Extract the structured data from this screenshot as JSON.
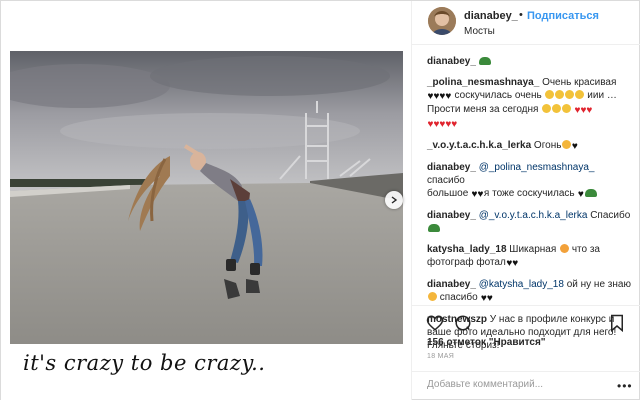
{
  "photo": {
    "caption": "it's crazy to be crazy..",
    "sky_color": "#8f8f95",
    "ground_color": "#9a9894"
  },
  "header": {
    "username": "dianabey_",
    "separator": "•",
    "follow_label": "Подписаться",
    "location": "Мосты"
  },
  "comments": [
    {
      "user": "dianabey_",
      "parts": [
        {
          "t": "emoji",
          "v": "turtle"
        }
      ]
    },
    {
      "user": "_polina_nesmashnaya_",
      "text": "Очень красивая",
      "line2": "соскучилась очень",
      "line2b": "иии …",
      "line3": "Прости меня за сегодня"
    },
    {
      "text": ""
    },
    {
      "user": "_v.o.y.t.a.c.h.k.a_lerka",
      "text": "Огонь"
    },
    {
      "user": "dianabey_",
      "mention": "@_polina_nesmashnaya_",
      "text": "спасибо",
      "line2": "большое",
      "line2b": "я тоже соскучилась"
    },
    {
      "user": "dianabey_",
      "mention": "@_v.o.y.t.a.c.h.k.a_lerka",
      "text": "Спасибо"
    },
    {
      "user": "katysha_lady_18",
      "text": "Шикарная",
      "text2": "что за",
      "line2": "фотограф фотал"
    },
    {
      "user": "dianabey_",
      "mention": "@katysha_lady_18",
      "text": "ой ну не знаю",
      "line2": "спасибо"
    },
    {
      "user": "mostnewszp",
      "text": "У нас в профиле конкурс и",
      "line2": "ваше фото идеально подходит для него!",
      "line3": "Гляньте сториз!"
    }
  ],
  "actions": {
    "likes": "156 отметок \"Нравится\"",
    "date": "18 МАЯ",
    "comment_placeholder": "Добавьте комментарий...",
    "more": "•••"
  },
  "colors": {
    "link_blue": "#3897f0",
    "text": "#262626",
    "muted": "#999999",
    "border": "#efefef"
  },
  "icons": [
    "next-arrow-icon",
    "heart-icon",
    "comment-icon",
    "bookmark-icon",
    "more-options-icon"
  ]
}
